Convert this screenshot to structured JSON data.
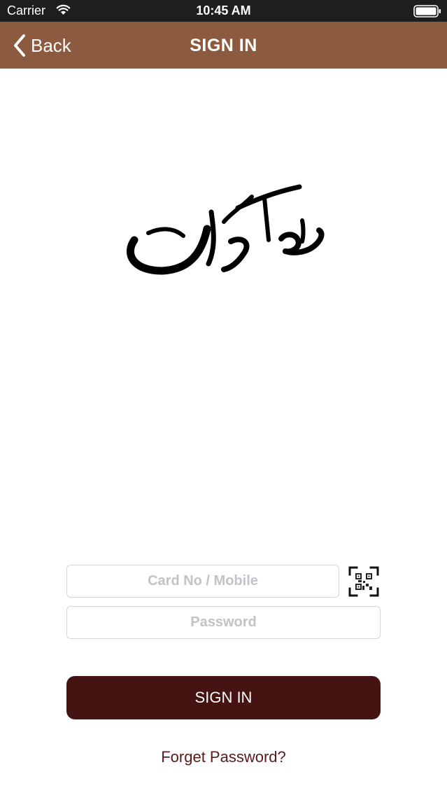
{
  "status_bar": {
    "carrier": "Carrier",
    "time": "10:45 AM",
    "wifi_icon": "wifi-icon",
    "battery_icon": "battery-icon"
  },
  "nav": {
    "back_label": "Back",
    "title": "SIGN IN",
    "back_icon": "chevron-left-icon"
  },
  "logo": {
    "icon": "calligraphy-logo"
  },
  "form": {
    "card_placeholder": "Card No / Mobile",
    "card_value": "",
    "password_placeholder": "Password",
    "password_value": "",
    "qr_icon": "qr-code-icon",
    "signin_label": "SIGN IN",
    "forgot_label": "Forget Password?"
  },
  "colors": {
    "nav_background": "#8b5a3f",
    "status_background": "#1e1e1e",
    "primary_button": "#461313",
    "link": "#5a1a1a"
  }
}
